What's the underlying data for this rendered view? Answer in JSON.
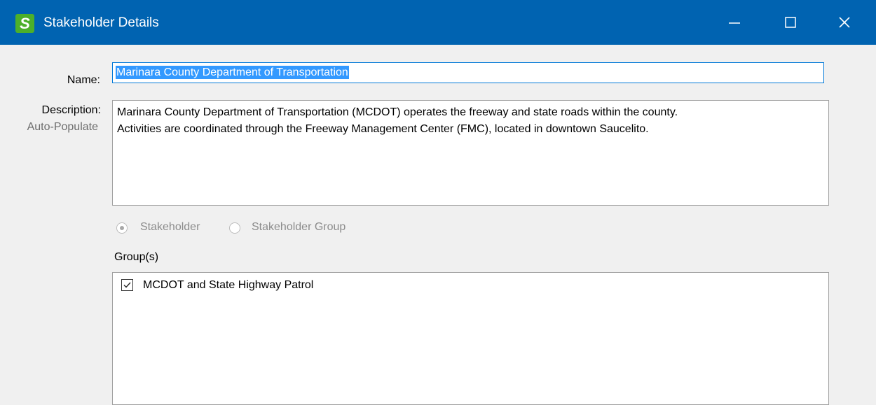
{
  "window": {
    "title": "Stakeholder Details",
    "app_icon_letter": "S",
    "minimize_icon": "minimize-icon",
    "maximize_icon": "maximize-icon",
    "close_icon": "close-icon",
    "title_bar_color": "#0063b1"
  },
  "form": {
    "name_label": "Name:",
    "name_value": "Marinara County Department of Transportation",
    "description_label": "Description:",
    "auto_populate_label": "Auto-Populate",
    "description_value": "Marinara County Department of Transportation (MCDOT) operates the freeway and state roads within the county.\nActivities are coordinated through the Freeway Management Center (FMC), located in downtown Saucelito.",
    "type_options": [
      {
        "label": "Stakeholder",
        "selected": true
      },
      {
        "label": "Stakeholder Group",
        "selected": false
      }
    ],
    "groups_label": "Group(s)",
    "groups": [
      {
        "label": "MCDOT and State Highway Patrol",
        "checked": true
      }
    ]
  }
}
